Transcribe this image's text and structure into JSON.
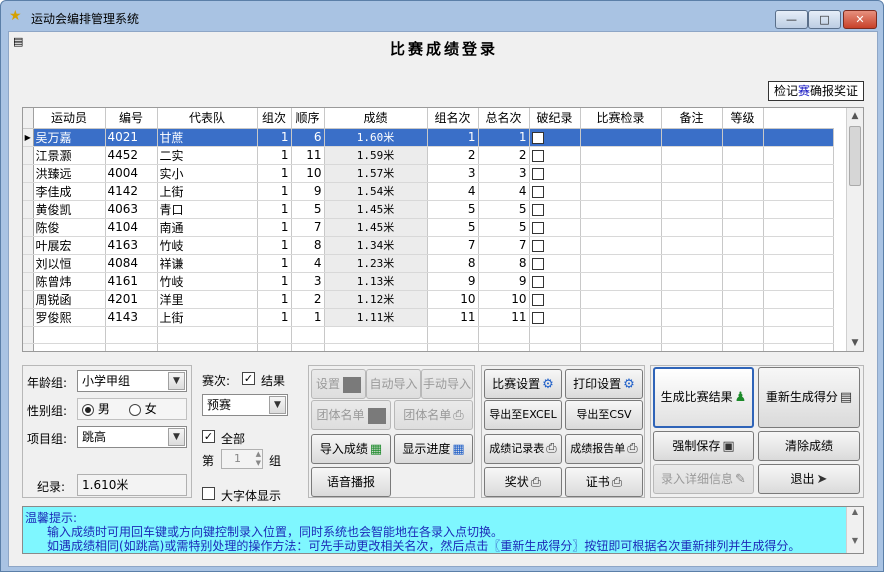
{
  "window": {
    "title": "运动会编排管理系统",
    "min_label": "—",
    "max_label": "□",
    "close_label": "✕"
  },
  "page": {
    "title": "比赛成绩登录",
    "top_link_part1": "检记",
    "top_link_part2": "赛",
    "top_link_part3": "确报奖证"
  },
  "grid": {
    "columns": [
      "运动员",
      "编号",
      "代表队",
      "组次",
      "顺序",
      "成绩",
      "组名次",
      "总名次",
      "破纪录",
      "比赛检录",
      "备注",
      "等级"
    ],
    "rows": [
      {
        "name": "吴万嘉",
        "id": "4021",
        "team": "甘蔗",
        "group": "1",
        "order": "6",
        "score": "1.60米",
        "grank": "1",
        "trank": "1",
        "selected": true
      },
      {
        "name": "江景灏",
        "id": "4452",
        "team": "二实",
        "group": "1",
        "order": "11",
        "score": "1.59米",
        "grank": "2",
        "trank": "2"
      },
      {
        "name": "洪臻远",
        "id": "4004",
        "team": "实小",
        "group": "1",
        "order": "10",
        "score": "1.57米",
        "grank": "3",
        "trank": "3"
      },
      {
        "name": "李佳成",
        "id": "4142",
        "team": "上街",
        "group": "1",
        "order": "9",
        "score": "1.54米",
        "grank": "4",
        "trank": "4"
      },
      {
        "name": "黄俊凯",
        "id": "4063",
        "team": "青口",
        "group": "1",
        "order": "5",
        "score": "1.45米",
        "grank": "5",
        "trank": "5"
      },
      {
        "name": "陈俊",
        "id": "4104",
        "team": "南通",
        "group": "1",
        "order": "7",
        "score": "1.45米",
        "grank": "5",
        "trank": "5"
      },
      {
        "name": "叶展宏",
        "id": "4163",
        "team": "竹岐",
        "group": "1",
        "order": "8",
        "score": "1.34米",
        "grank": "7",
        "trank": "7"
      },
      {
        "name": "刘以恒",
        "id": "4084",
        "team": "祥谦",
        "group": "1",
        "order": "4",
        "score": "1.23米",
        "grank": "8",
        "trank": "8"
      },
      {
        "name": "陈曾炜",
        "id": "4161",
        "team": "竹岐",
        "group": "1",
        "order": "3",
        "score": "1.13米",
        "grank": "9",
        "trank": "9"
      },
      {
        "name": "周锐函",
        "id": "4201",
        "team": "洋里",
        "group": "1",
        "order": "2",
        "score": "1.12米",
        "grank": "10",
        "trank": "10"
      },
      {
        "name": "罗俊熙",
        "id": "4143",
        "team": "上街",
        "group": "1",
        "order": "1",
        "score": "1.11米",
        "grank": "11",
        "trank": "11"
      }
    ]
  },
  "filters": {
    "age_label": "年龄组:",
    "age_value": "小学甲组",
    "gender_label": "性别组:",
    "gender_male": "男",
    "gender_female": "女",
    "event_label": "项目组:",
    "event_value": "跳高",
    "record_label": "纪录:",
    "record_value": "1.610米"
  },
  "round": {
    "label": "赛次:",
    "result_label": "结果",
    "value": "预赛",
    "all_label": "全部",
    "group_prefix": "第",
    "group_value": "1",
    "group_suffix": "组",
    "bigfont_label": "大字体显示"
  },
  "buttons": {
    "setup": "设置",
    "auto_import": "自动导入",
    "manual_import": "手动导入",
    "team_list1": "团体名单",
    "team_list2": "团体名单",
    "import_scores": "导入成绩",
    "show_progress": "显示进度",
    "voice": "语音播报",
    "match_setup": "比赛设置",
    "print_setup": "打印设置",
    "export_excel": "导出至EXCEL",
    "export_csv": "导出至CSV",
    "record_table": "成绩记录表",
    "report_sheet": "成绩报告单",
    "award": "奖状",
    "certificate": "证书",
    "gen_result": "生成比赛结果",
    "regen_score": "重新生成得分",
    "force_save": "强制保存",
    "clear_scores": "清除成绩",
    "enter_details": "录入详细信息",
    "exit": "退出"
  },
  "tips": {
    "title": "温馨提示:",
    "line1": "输入成绩时可用回车键或方向键控制录入位置，同时系统也会智能地在各录入点切换。",
    "line2": "如遇成绩相同(如跳高)或需特别处理的操作方法：可先手动更改相关名次，然后点击〖重新生成得分〗按钮即可根据名次重新排列并生成得分。"
  }
}
